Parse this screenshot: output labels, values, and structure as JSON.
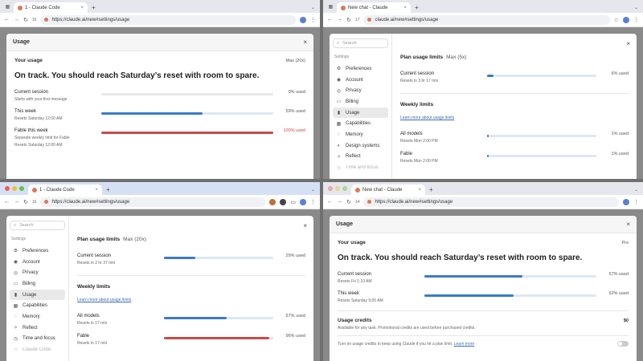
{
  "p1": {
    "tab_title": "1 - Claude Code",
    "tab_count": "16",
    "url": "https://claude.ai/new#settings/usage",
    "modal_title": "Usage",
    "your_usage": "Your usage",
    "plan": "Max (20x)",
    "headline": "On track. You should reach Saturday’s reset with room to spare.",
    "rows": [
      {
        "title": "Current session",
        "sub": "Starts with your first message",
        "sub2": "",
        "pct_label": "0% used",
        "pct": 0,
        "color": "gray"
      },
      {
        "title": "This week",
        "sub": "Resets Saturday 12:00 AM",
        "sub2": "",
        "pct_label": "59% used",
        "pct": 59,
        "color": "blue"
      },
      {
        "title": "Fable this week",
        "sub": "Separate weekly limit for Fable",
        "sub2": "Resets Saturday 12:00 AM",
        "pct_label": "100% used",
        "pct": 100,
        "color": "red"
      }
    ]
  },
  "p2": {
    "tab_title": "New chat - Claude",
    "tab_count": "17",
    "url": "claude.ai/new#settings/usage",
    "search_placeholder": "Search",
    "settings_label": "Settings",
    "nav": [
      "Preferences",
      "Account",
      "Privacy",
      "Billing",
      "Usage",
      "Capabilities",
      "Memory",
      "Design systems",
      "Reflect",
      "Time and focus"
    ],
    "plan_title": "Plan usage limits",
    "plan": "Max (5x)",
    "session_title": "Current session",
    "session_sub": "Resets in 3 hr 17 min",
    "session_pct_label": "6% used",
    "session_pct": 6,
    "weekly_title": "Weekly limits",
    "learn_more": "Learn more about usage limits",
    "weekly": [
      {
        "title": "All models",
        "sub": "Resets Mon 2:00 PM",
        "pct_label": "1% used",
        "pct": 1
      },
      {
        "title": "Fable",
        "sub": "Resets Mon 2:00 PM",
        "pct_label": "1% used",
        "pct": 1
      }
    ]
  },
  "p3": {
    "tab_title": "1 - Claude Code",
    "tab_count": "16",
    "url": "https://claude.ai/new#settings/usage",
    "search_placeholder": "Search",
    "settings_label": "Settings",
    "nav": [
      "Preferences",
      "Account",
      "Privacy",
      "Billing",
      "Usage",
      "Capabilities",
      "Memory",
      "Reflect",
      "Time and focus",
      "Claude Code"
    ],
    "plan_title": "Plan usage limits",
    "plan": "Max (20x)",
    "session_title": "Current session",
    "session_sub": "Resets in 2 hr 37 min",
    "session_pct_label": "29% used",
    "session_pct": 29,
    "weekly_title": "Weekly limits",
    "learn_more": "Learn more about usage limits",
    "weekly": [
      {
        "title": "All models",
        "sub": "Resets in 17 min",
        "pct_label": "57% used",
        "pct": 57,
        "color": "blue"
      },
      {
        "title": "Fable",
        "sub": "Resets in 17 min",
        "pct_label": "96% used",
        "pct": 96,
        "color": "red"
      }
    ]
  },
  "p4": {
    "tab_title": "New chat - Claude",
    "tab_count": "14",
    "url": "https://claude.ai/new#settings/usage",
    "modal_title": "Usage",
    "your_usage": "Your usage",
    "plan": "Pro",
    "headline": "On track. You should reach Saturday’s reset with room to spare.",
    "rows": [
      {
        "title": "Current session",
        "sub": "Resets Fri 1:10 AM",
        "pct_label": "57% used",
        "pct": 57
      },
      {
        "title": "This week",
        "sub": "Resets Saturday 9:00 AM",
        "pct_label": "52% used",
        "pct": 52
      }
    ],
    "credits_title": "Usage credits",
    "credits_value": "$0",
    "credits_sub": "Available for any task. Promotional credits are used before purchased credits.",
    "credits_toggle_text": "Turn on usage credits to keep using Claude if you hit a plan limit.",
    "credits_learn": "Learn more"
  },
  "icons": {
    "back": "←",
    "forward": "→",
    "reload": "↻",
    "close": "×",
    "plus": "+",
    "chevron": "⌄",
    "search": "⌕",
    "star": "☆",
    "menu": "⋮"
  },
  "colors": {
    "blue": "#3b7ac8",
    "red": "#c74a4a",
    "track": "#dce8f5",
    "accent": "#d87a5a"
  }
}
